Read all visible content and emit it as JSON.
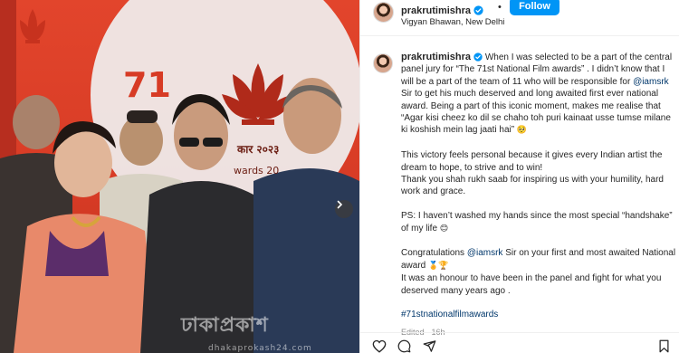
{
  "post": {
    "username": "prakrutimishra",
    "separator": "•",
    "follow_label": "Follow",
    "location": "Vigyan Bhawan, New Delhi"
  },
  "photo": {
    "banner_number": "71",
    "banner_hindi": "कार २०२३",
    "banner_awards": "wards 20",
    "watermark_logo": "ঢাকাপ্রকাশ",
    "watermark_url": "dhakaprokash24.com"
  },
  "caption": {
    "username": "prakrutimishra",
    "p1_a": "When I was selected to be a part of the central panel jury for “The 71st National Film awards” . I didn’t know that I will be a part of the team of 11 who will be responsible for",
    "p1_mention": "@iamsrk",
    "p1_b": "Sir to get his much deserved and long awaited first ever national award. Being a part of this iconic moment, makes me realise that “Agar kisi cheez ko dil se chaho toh puri kainaat usse tumse milane ki koshish mein lag jaati hai”",
    "p1_emoji": "🥺",
    "p2": "This victory feels personal because it gives every Indian artist the dream to hope, to strive and to win!\nThank you shah rukh saab for inspiring us with your humility, hard work and grace.",
    "p3_a": "PS: I haven’t washed my hands since the most special “handshake” of my life",
    "p3_emoji": "😊",
    "p4_a": "Congratulations",
    "p4_mention": "@iamsrk",
    "p4_b": "Sir on your first and most awaited National award",
    "p4_emoji": "🏅🏆",
    "p4_c": "It was an honour to have been in the panel and fight for what you deserved many years ago .",
    "hashtag": "#71stnationalfilmawards",
    "edited": "Edited · 16h"
  },
  "icons": {
    "verified": "verified-badge-icon",
    "like": "heart-icon",
    "comment": "comment-icon",
    "share": "share-icon",
    "save": "bookmark-icon",
    "next": "chevron-right-icon"
  },
  "colors": {
    "accent": "#0095f6",
    "link": "#00376b",
    "muted": "#8e8e8e",
    "banner_red": "#d73b25"
  }
}
